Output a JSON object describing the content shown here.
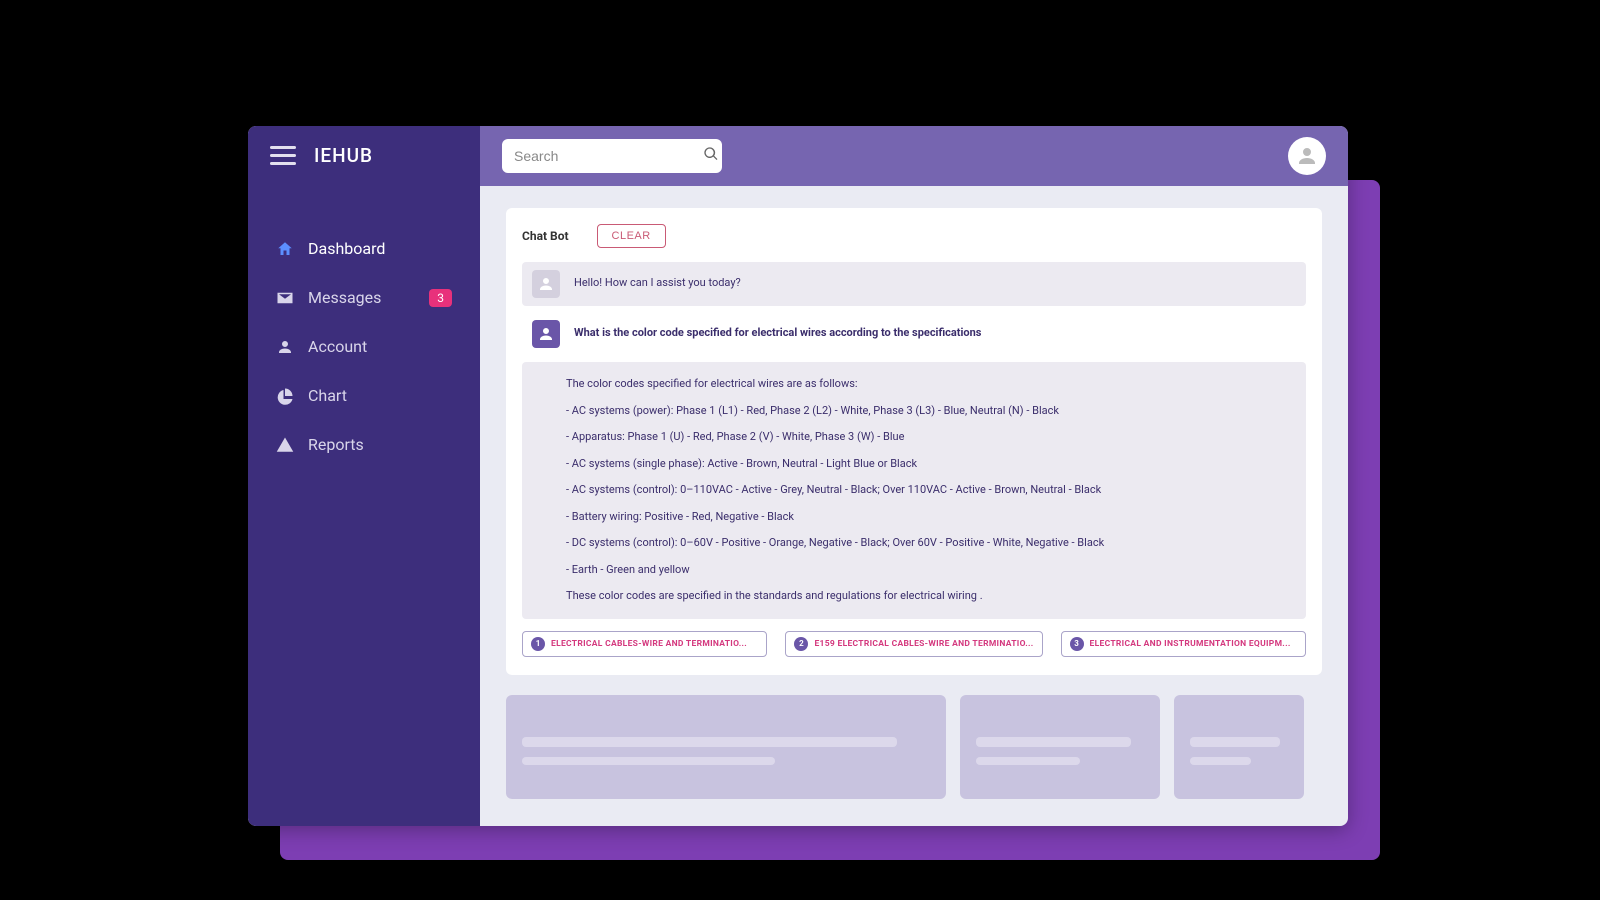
{
  "brand": "IEHUB",
  "search": {
    "placeholder": "Search"
  },
  "sidebar": {
    "items": [
      {
        "label": "Dashboard",
        "icon": "home",
        "active": true
      },
      {
        "label": "Messages",
        "icon": "mail",
        "badge": "3"
      },
      {
        "label": "Account",
        "icon": "user"
      },
      {
        "label": "Chart",
        "icon": "chart"
      },
      {
        "label": "Reports",
        "icon": "alert"
      }
    ]
  },
  "chat": {
    "title": "Chat Bot",
    "clear_label": "CLEAR",
    "greeting": "Hello! How can I assist you today?",
    "user_question": "What is the color code specified for electrical wires according to the specifications",
    "answer": {
      "intro": "The color codes specified for electrical wires are as follows:",
      "lines": [
        "- AC systems (power): Phase 1 (L1) - Red, Phase 2 (L2) - White, Phase 3 (L3) - Blue, Neutral (N) - Black",
        "- Apparatus: Phase 1 (U) - Red, Phase 2 (V) - White, Phase 3 (W) - Blue",
        "- AC systems (single phase): Active - Brown, Neutral - Light Blue or Black",
        "- AC systems (control): 0–110VAC - Active - Grey, Neutral - Black; Over 110VAC - Active - Brown, Neutral - Black",
        "- Battery wiring: Positive - Red, Negative - Black",
        "- DC systems (control): 0–60V - Positive - Orange, Negative - Black; Over 60V - Positive - White, Negative - Black",
        "- Earth - Green and yellow"
      ],
      "outro": "These color codes are specified in the standards and regulations for electrical wiring ."
    },
    "chips": [
      {
        "num": "1",
        "label": "ELECTRICAL CABLES-WIRE AND TERMINATIO..."
      },
      {
        "num": "2",
        "label": "E159 ELECTRICAL CABLES-WIRE AND TERMINATIO..."
      },
      {
        "num": "3",
        "label": "ELECTRICAL AND INSTRUMENTATION EQUIPM..."
      }
    ]
  }
}
